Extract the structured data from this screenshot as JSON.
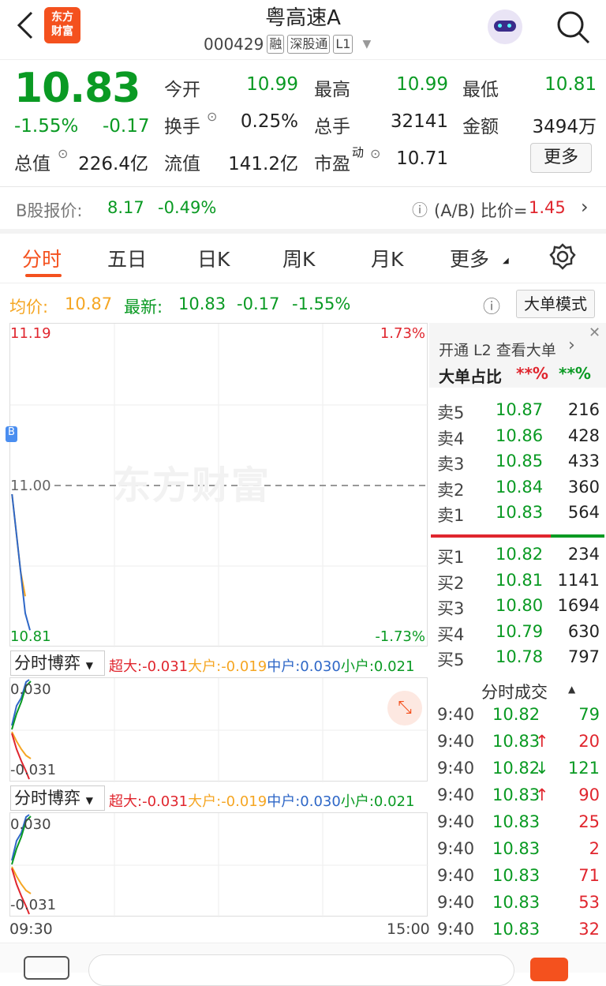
{
  "header": {
    "title": "粤高速A",
    "code": "000429",
    "tags": [
      "融",
      "深股通",
      "L1"
    ],
    "logo_line1": "东方",
    "logo_line2": "财富"
  },
  "quote": {
    "price": "10.83",
    "pct": "-1.55%",
    "chg": "-0.17",
    "open_label": "今开",
    "open": "10.99",
    "high_label": "最高",
    "high": "10.99",
    "low_label": "最低",
    "low": "10.81",
    "turnover_label": "换手",
    "turnover": "0.25%",
    "volume_label": "总手",
    "volume": "32141",
    "amount_label": "金额",
    "amount": "3494万",
    "mktcap_label": "总值",
    "mktcap": "226.4亿",
    "float_label": "流值",
    "float": "141.2亿",
    "pe_label": "市盈",
    "pe_sup": "动",
    "pe": "10.71",
    "more": "更多"
  },
  "bshare": {
    "label": "B股报价:",
    "price": "8.17",
    "pct": "-0.49%",
    "ratio_label": "(A/B) 比价=",
    "ratio": "1.45"
  },
  "tabs": [
    "分时",
    "五日",
    "日K",
    "周K",
    "月K",
    "更多"
  ],
  "infobar": {
    "avg_label": "均价:",
    "avg": "10.87",
    "last_label": "最新:",
    "last": "10.83",
    "chg": "-0.17",
    "pct": "-1.55%",
    "mode": "大单模式"
  },
  "chart": {
    "ymax": "11.19",
    "ymin": "10.81",
    "pmax": "1.73%",
    "pmin": "-1.73%",
    "mid": "11.00",
    "watermark": "东方财富",
    "t_start": "09:30",
    "t_end": "15:00",
    "b_badge": "B"
  },
  "chart_data": {
    "type": "line",
    "series": [
      {
        "name": "均价",
        "values": [
          11.0,
          10.95,
          10.9,
          10.87
        ]
      },
      {
        "name": "最新",
        "values": [
          11.0,
          10.95,
          10.9,
          10.85,
          10.83
        ]
      }
    ]
  },
  "flow": {
    "select": "分时博弈",
    "chao_label": "超大:",
    "chao": "-0.031",
    "da_label": "大户:",
    "da": "-0.019",
    "zhong_label": "中户:",
    "zhong": "0.030",
    "xiao_label": "小户:",
    "xiao": "0.021",
    "top": "0.030",
    "bottom": "-0.031"
  },
  "orderbook": {
    "l2": "开通 L2 查看大单",
    "ratio_label": "大单占比",
    "ratio_red": "**%",
    "ratio_green": "**%",
    "asks": [
      {
        "label": "卖5",
        "price": "10.87",
        "vol": "216"
      },
      {
        "label": "卖4",
        "price": "10.86",
        "vol": "428"
      },
      {
        "label": "卖3",
        "price": "10.85",
        "vol": "433"
      },
      {
        "label": "卖2",
        "price": "10.84",
        "vol": "360"
      },
      {
        "label": "卖1",
        "price": "10.83",
        "vol": "564"
      }
    ],
    "bids": [
      {
        "label": "买1",
        "price": "10.82",
        "vol": "234"
      },
      {
        "label": "买2",
        "price": "10.81",
        "vol": "1141"
      },
      {
        "label": "买3",
        "price": "10.80",
        "vol": "1694"
      },
      {
        "label": "买4",
        "price": "10.79",
        "vol": "630"
      },
      {
        "label": "买5",
        "price": "10.78",
        "vol": "797"
      }
    ]
  },
  "trades": {
    "title": "分时成交",
    "rows": [
      {
        "t": "9:40",
        "p": "10.82",
        "a": "",
        "v": "79",
        "vc": "g",
        "pc": "g"
      },
      {
        "t": "9:40",
        "p": "10.83",
        "a": "↑",
        "v": "20",
        "vc": "r",
        "pc": "g"
      },
      {
        "t": "9:40",
        "p": "10.82",
        "a": "↓",
        "v": "121",
        "vc": "g",
        "pc": "g"
      },
      {
        "t": "9:40",
        "p": "10.83",
        "a": "↑",
        "v": "90",
        "vc": "r",
        "pc": "g"
      },
      {
        "t": "9:40",
        "p": "10.83",
        "a": "",
        "v": "25",
        "vc": "r",
        "pc": "g"
      },
      {
        "t": "9:40",
        "p": "10.83",
        "a": "",
        "v": "2",
        "vc": "r",
        "pc": "g"
      },
      {
        "t": "9:40",
        "p": "10.83",
        "a": "",
        "v": "71",
        "vc": "r",
        "pc": "g"
      },
      {
        "t": "9:40",
        "p": "10.83",
        "a": "",
        "v": "53",
        "vc": "r",
        "pc": "g"
      },
      {
        "t": "9:40",
        "p": "10.83",
        "a": "",
        "v": "32",
        "vc": "r",
        "pc": "g"
      }
    ]
  }
}
